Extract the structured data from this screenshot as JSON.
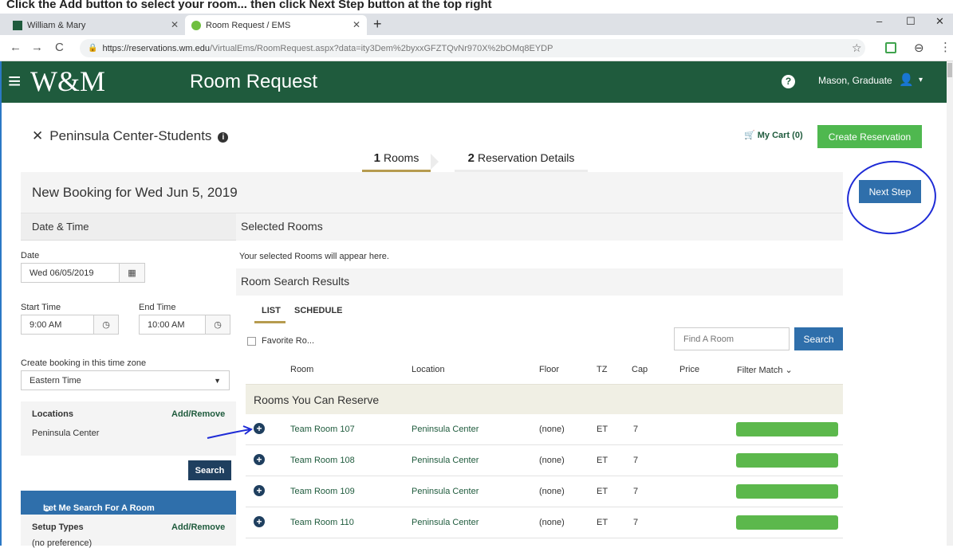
{
  "banner": {
    "text": "Click the Add button to select your room... then click Next Step button at the top right"
  },
  "browser": {
    "tabs": [
      {
        "label": "William & Mary",
        "active": false
      },
      {
        "label": "Room Request / EMS",
        "active": true
      }
    ],
    "new_tab": "+",
    "url_host": "https://reservations.wm.edu",
    "url_path": "/VirtualEms/RoomRequest.aspx?data=ity3Dem%2byxxGFZTQvNr970X%2bOMq8EYDP",
    "controls": {
      "minimize": "–",
      "maximize": "☐",
      "close": "✕",
      "back": "←",
      "forward": "→",
      "reload": "C"
    }
  },
  "header": {
    "logo": "W&M",
    "title": "Room Request",
    "help": "?",
    "user": "Mason, Graduate"
  },
  "template": {
    "name": "Peninsula Center-Students",
    "cart_label": "My Cart (0)",
    "create_button": "Create Reservation"
  },
  "steps": [
    {
      "num": "1",
      "label": "Rooms",
      "active": true
    },
    {
      "num": "2",
      "label": "Reservation Details",
      "active": false
    }
  ],
  "booking": {
    "title": "New Booking for Wed Jun 5, 2019",
    "next_button": "Next Step"
  },
  "left_panel": {
    "heading": "Date & Time",
    "date_label": "Date",
    "date_value": "Wed 06/05/2019",
    "start_label": "Start Time",
    "start_value": "9:00 AM",
    "end_label": "End Time",
    "end_value": "10:00 AM",
    "tz_label": "Create booking in this time zone",
    "tz_value": "Eastern Time",
    "locations_label": "Locations",
    "locations_action": "Add/Remove",
    "locations_value": "Peninsula Center",
    "search_button": "Search",
    "let_me_search": "Let Me Search For A Room",
    "setup_label": "Setup Types",
    "setup_action": "Add/Remove",
    "setup_value": "(no preference)"
  },
  "selected": {
    "heading": "Selected Rooms",
    "empty_text": "Your selected Rooms will appear here."
  },
  "results": {
    "heading": "Room Search Results",
    "tabs": [
      "LIST",
      "SCHEDULE"
    ],
    "favorite_label": "Favorite Ro...",
    "find_placeholder": "Find A Room",
    "search_button": "Search",
    "columns": [
      "Room",
      "Location",
      "Floor",
      "TZ",
      "Cap",
      "Price",
      "Filter Match"
    ],
    "group_title": "Rooms You Can Reserve",
    "rows": [
      {
        "room": "Team Room 107",
        "location": "Peninsula Center",
        "floor": "(none)",
        "tz": "ET",
        "cap": "7",
        "price": "",
        "match": 1.0
      },
      {
        "room": "Team Room 108",
        "location": "Peninsula Center",
        "floor": "(none)",
        "tz": "ET",
        "cap": "7",
        "price": "",
        "match": 1.0
      },
      {
        "room": "Team Room 109",
        "location": "Peninsula Center",
        "floor": "(none)",
        "tz": "ET",
        "cap": "7",
        "price": "",
        "match": 1.0
      },
      {
        "room": "Team Room 110",
        "location": "Peninsula Center",
        "floor": "(none)",
        "tz": "ET",
        "cap": "7",
        "price": "",
        "match": 1.0
      }
    ]
  },
  "colors": {
    "brand_green": "#1f5b3d",
    "accent_blue": "#2f6fab",
    "gold": "#b69b4f",
    "match_green": "#5cb84c"
  }
}
